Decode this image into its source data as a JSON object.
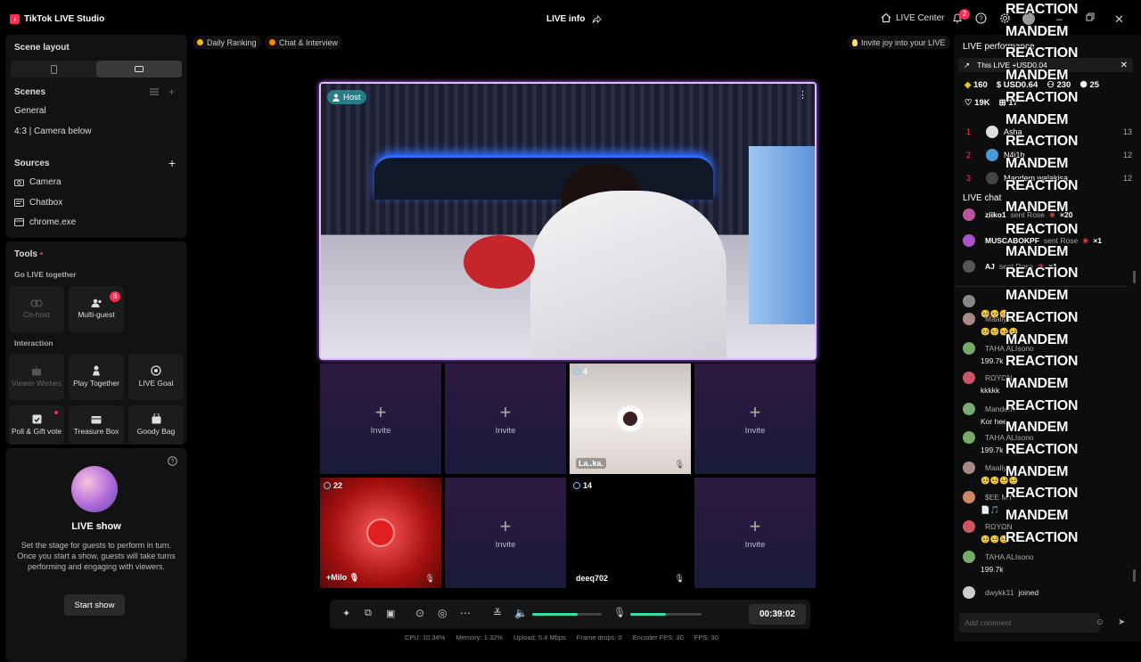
{
  "app": {
    "title": "TikTok LIVE Studio",
    "center_title": "LIVE info",
    "live_center": "LIVE Center",
    "notif_count": "2"
  },
  "left": {
    "scene_layout": "Scene layout",
    "scenes": {
      "title": "Scenes",
      "items": [
        "General",
        "4:3 | Camera below"
      ]
    },
    "sources": {
      "title": "Sources",
      "items": [
        "Camera",
        "Chatbox",
        "chrome.exe"
      ]
    },
    "tools": {
      "title": "Tools",
      "go_live": "Go LIVE together",
      "cohost": "Co-host",
      "multiguest": "Multi-guest",
      "multiguest_badge": "8",
      "interaction": "Interaction",
      "viewer_wishes": "Viewer Wishes",
      "play_together": "Play Together",
      "live_goal": "LIVE Goal",
      "poll": "Poll & Gift vote",
      "treasure": "Treasure Box",
      "goody": "Goody Bag"
    },
    "show": {
      "title": "LIVE show",
      "desc": "Set the stage for guests to perform in turn. Once you start a show, guests will take turns performing and engaging with viewers.",
      "button": "Start show"
    }
  },
  "center": {
    "pills": [
      "Daily Ranking",
      "Chat & Interview"
    ],
    "invite_joy": "Invite joy into your LIVE",
    "host_label": "Host",
    "tiles": [
      {
        "type": "invite",
        "label": "Invite"
      },
      {
        "type": "invite",
        "label": "Invite"
      },
      {
        "type": "guest",
        "count": "4",
        "name": "La..ka."
      },
      {
        "type": "invite",
        "label": "Invite"
      },
      {
        "type": "guest",
        "count": "22",
        "name": "+Milo 🎙"
      },
      {
        "type": "invite",
        "label": "Invite"
      },
      {
        "type": "guest",
        "count": "14",
        "name": "deeq702"
      },
      {
        "type": "invite",
        "label": "Invite"
      }
    ],
    "timer": "00:39:02",
    "stats": [
      "CPU: 10.34%",
      "Memory: 1.32%",
      "Upload: 5.4 Mbps",
      "Frame drops: 0",
      "Encoder FPS: 30",
      "FPS: 30"
    ],
    "volume_fill": 0.65,
    "mic_fill": 0.5
  },
  "right": {
    "perf_title": "LIVE performance",
    "this_live": "This LIVE +USD0.04",
    "metrics": [
      "160",
      "USD0.64",
      "230",
      "25",
      "19K",
      "17"
    ],
    "ranking": [
      {
        "rank": "1",
        "name": "Asha",
        "score": "13"
      },
      {
        "rank": "2",
        "name": "N4j1b",
        "score": "12"
      },
      {
        "rank": "3",
        "name": "Mandem walakisa",
        "score": "12"
      }
    ],
    "chat_title": "LIVE chat",
    "gifts": [
      {
        "name": "ziiko1",
        "text": "sent Rose",
        "count": "×20"
      },
      {
        "name": "MUSCABOKPF",
        "text": "sent Rose",
        "count": "×1"
      },
      {
        "name": "AJ",
        "text": "sent Rose",
        "count": "×1"
      }
    ],
    "messages": [
      {
        "name": "",
        "text": "🥺🥺🥺"
      },
      {
        "name": "Maaliya",
        "text": "🥺🥺🥺🥺"
      },
      {
        "name": "TAHA ALIsono",
        "text": "199.7k"
      },
      {
        "name": "RΩYΩN",
        "text": "kkkkk"
      },
      {
        "name": "Mandem",
        "text": "Kor hee"
      },
      {
        "name": "TAHA ALIsono",
        "text": "199.7k"
      },
      {
        "name": "Maaliya",
        "text": "🥺🥺🥺🥺"
      },
      {
        "name": "$EE MY",
        "text": "📄🎵"
      },
      {
        "name": "RΩYΩN",
        "text": "🥺🥺🥺"
      },
      {
        "name": "TAHA ALIsono",
        "text": "199.7k"
      }
    ],
    "joined": {
      "name": "dwykk11",
      "text": "joined"
    },
    "add_comment": "Add comment"
  },
  "overlay": {
    "lines": [
      "REACTION",
      "MANDEM",
      "REACTION",
      "MANDEM",
      "REACTION",
      "MANDEM",
      "REACTION",
      "MANDEM",
      "REACTION",
      "MANDEM",
      "REACTION",
      "MANDEM",
      "REACTION",
      "MANDEM",
      "REACTION",
      "MANDEM",
      "REACTION",
      "MANDEM",
      "REACTION",
      "MANDEM",
      "REACTION",
      "MANDEM",
      "REACTION",
      "MANDEM",
      "REACTION"
    ]
  }
}
